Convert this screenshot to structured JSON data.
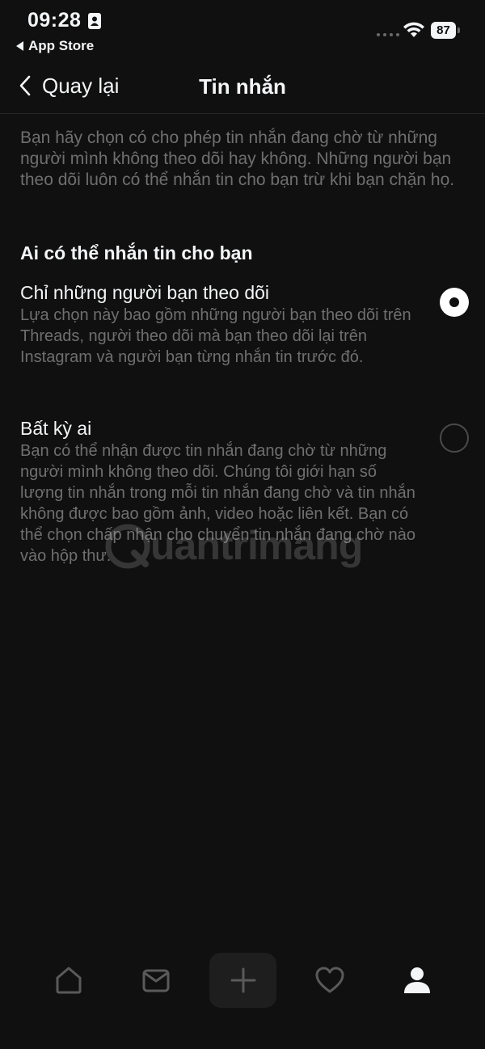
{
  "status_bar": {
    "time": "09:28",
    "back_app_label": "App Store",
    "battery_level": "87"
  },
  "nav": {
    "back_label": "Quay lại",
    "title": "Tin nhắn"
  },
  "intro_text": "Bạn hãy chọn có cho phép tin nhắn đang chờ từ những người mình không theo dõi hay không. Những người bạn theo dõi luôn có thể nhắn tin cho bạn trừ khi bạn chặn họ.",
  "section": {
    "title": "Ai có thể nhắn tin cho bạn",
    "options": [
      {
        "title": "Chỉ những người bạn theo dõi",
        "description": "Lựa chọn này bao gồm những người bạn theo dõi trên Threads, người theo dõi mà bạn theo dõi lại trên Instagram và người bạn từng nhắn tin trước đó.",
        "selected": true
      },
      {
        "title": "Bất kỳ ai",
        "description": "Bạn có thể nhận được tin nhắn đang chờ từ những người mình không theo dõi. Chúng tôi giới hạn số lượng tin nhắn trong mỗi tin nhắn đang chờ và tin nhắn không được bao gồm ảnh, video hoặc liên kết. Bạn có thể chọn chấp nhận cho chuyển tin nhắn đang chờ nào vào hộp thư.",
        "selected": false
      }
    ]
  },
  "watermark": "uantrimang",
  "tab_bar": {
    "icons": [
      "home-icon",
      "inbox-icon",
      "plus-icon",
      "heart-icon",
      "profile-icon"
    ]
  },
  "colors": {
    "background": "#101010",
    "text_primary": "#f3f5f7",
    "text_secondary": "#6f6f6f",
    "radio_unselected": "#4a4a4a"
  }
}
